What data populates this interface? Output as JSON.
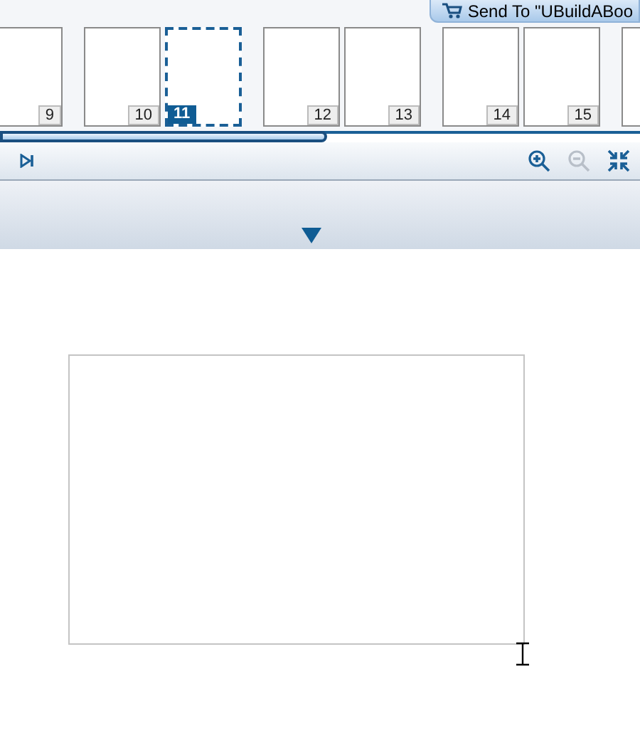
{
  "send_button": {
    "label": "Send To \"UBuildABoo"
  },
  "spreads": [
    {
      "pages": [
        {
          "label": "9",
          "selected": false
        }
      ]
    },
    {
      "pages": [
        {
          "label": "10",
          "selected": false
        },
        {
          "label": "11",
          "selected": true
        }
      ]
    },
    {
      "pages": [
        {
          "label": "12",
          "selected": false
        },
        {
          "label": "13",
          "selected": false
        }
      ]
    },
    {
      "pages": [
        {
          "label": "14",
          "selected": false
        },
        {
          "label": "15",
          "selected": false
        }
      ]
    }
  ]
}
